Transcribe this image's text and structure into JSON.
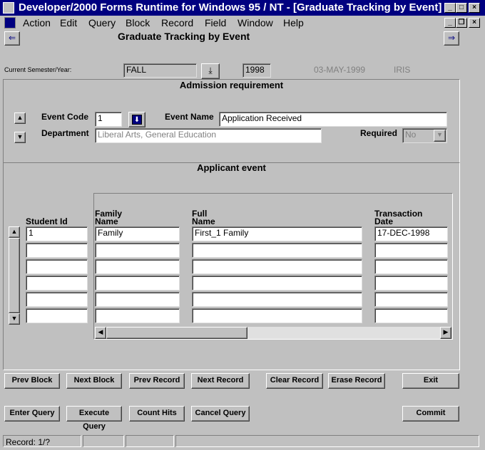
{
  "window": {
    "title": "Developer/2000 Forms Runtime for Windows 95 / NT - [Graduate Tracking by Event]",
    "minimize": "_",
    "maximize": "□",
    "close": "×"
  },
  "menu": [
    "Action",
    "Edit",
    "Query",
    "Block",
    "Record",
    "Field",
    "Window",
    "Help"
  ],
  "mdi_controls": {
    "minimize": "_",
    "restore": "❐",
    "close": "×"
  },
  "form": {
    "title": "Graduate Tracking by Event",
    "nav_left": "⇐",
    "nav_right": "⇒",
    "semester_label": "Current Semester/Year:",
    "semester_value": "FALL",
    "year_value": "1998",
    "date_value": "03-MAY-1999",
    "user_value": "IRIS"
  },
  "admission": {
    "title": "Admission requirement",
    "event_code_label": "Event Code",
    "event_code_value": "1",
    "event_name_label": "Event Name",
    "event_name_value": "Application Received",
    "department_label": "Department",
    "department_value": "Liberal Arts, General Education",
    "required_label": "Required",
    "required_value": "No"
  },
  "applicant": {
    "title": "Applicant event",
    "columns": {
      "student_id": "Student Id",
      "family_name_1": "Family",
      "family_name_2": "Name",
      "full_name_1": "Full",
      "full_name_2": "Name",
      "transaction_1": "Transaction",
      "transaction_2": "Date"
    },
    "rows": [
      {
        "student_id": "1",
        "family_name": "Family",
        "full_name": "First_1  Family",
        "date": "17-DEC-1998"
      },
      {
        "student_id": "",
        "family_name": "",
        "full_name": "",
        "date": ""
      },
      {
        "student_id": "",
        "family_name": "",
        "full_name": "",
        "date": ""
      },
      {
        "student_id": "",
        "family_name": "",
        "full_name": "",
        "date": ""
      },
      {
        "student_id": "",
        "family_name": "",
        "full_name": "",
        "date": ""
      },
      {
        "student_id": "",
        "family_name": "",
        "full_name": "",
        "date": ""
      }
    ]
  },
  "buttons": {
    "prev_block": "Prev Block",
    "next_block": "Next Block",
    "prev_record": "Prev Record",
    "next_record": "Next Record",
    "clear_record": "Clear Record",
    "erase_record": "Erase Record",
    "exit": "Exit",
    "enter_query": "Enter Query",
    "execute_query": "Execute Query",
    "count_hits": "Count Hits",
    "cancel_query": "Cancel Query",
    "commit": "Commit"
  },
  "status": {
    "record": "Record: 1/?"
  }
}
